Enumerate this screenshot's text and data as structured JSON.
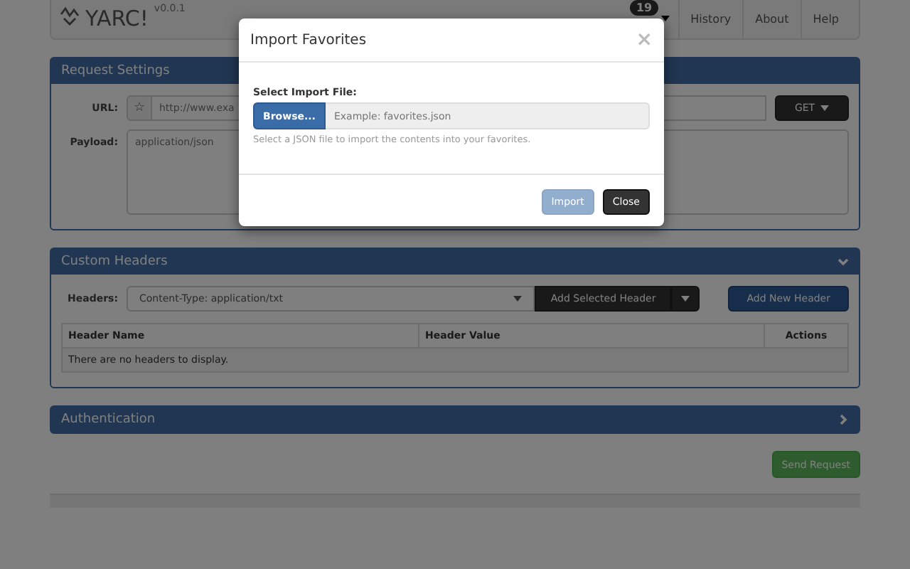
{
  "navbar": {
    "brand": "YARC!",
    "version": "v0.0.1",
    "badge": "19",
    "links": [
      {
        "label": "History"
      },
      {
        "label": "About"
      },
      {
        "label": "Help"
      }
    ]
  },
  "request_settings": {
    "title": "Request Settings",
    "url_label": "URL:",
    "url_placeholder": "http://www.exa",
    "favorite_glyph": "☆",
    "method": "GET",
    "payload_label": "Payload:",
    "payload_placeholder": "application/json"
  },
  "custom_headers": {
    "title": "Custom Headers",
    "expanded": true,
    "headers_label": "Headers:",
    "select_value": "Content-Type: application/txt",
    "add_selected": "Add Selected Header",
    "add_new": "Add New Header",
    "columns": [
      "Header Name",
      "Header Value",
      "Actions"
    ],
    "empty_text": "There are no headers to display."
  },
  "authentication": {
    "title": "Authentication",
    "expanded": false
  },
  "send_button": "Send Request",
  "modal": {
    "title": "Import Favorites",
    "close_glyph": "×",
    "field_label": "Select Import File:",
    "browse": "Browse...",
    "file_placeholder": "Example: favorites.json",
    "help": "Select a JSON file to import the contents into your favorites.",
    "buttons": [
      {
        "label": "Import",
        "kind": "primary",
        "disabled": true
      },
      {
        "label": "Close",
        "kind": "dark",
        "disabled": false
      }
    ]
  }
}
